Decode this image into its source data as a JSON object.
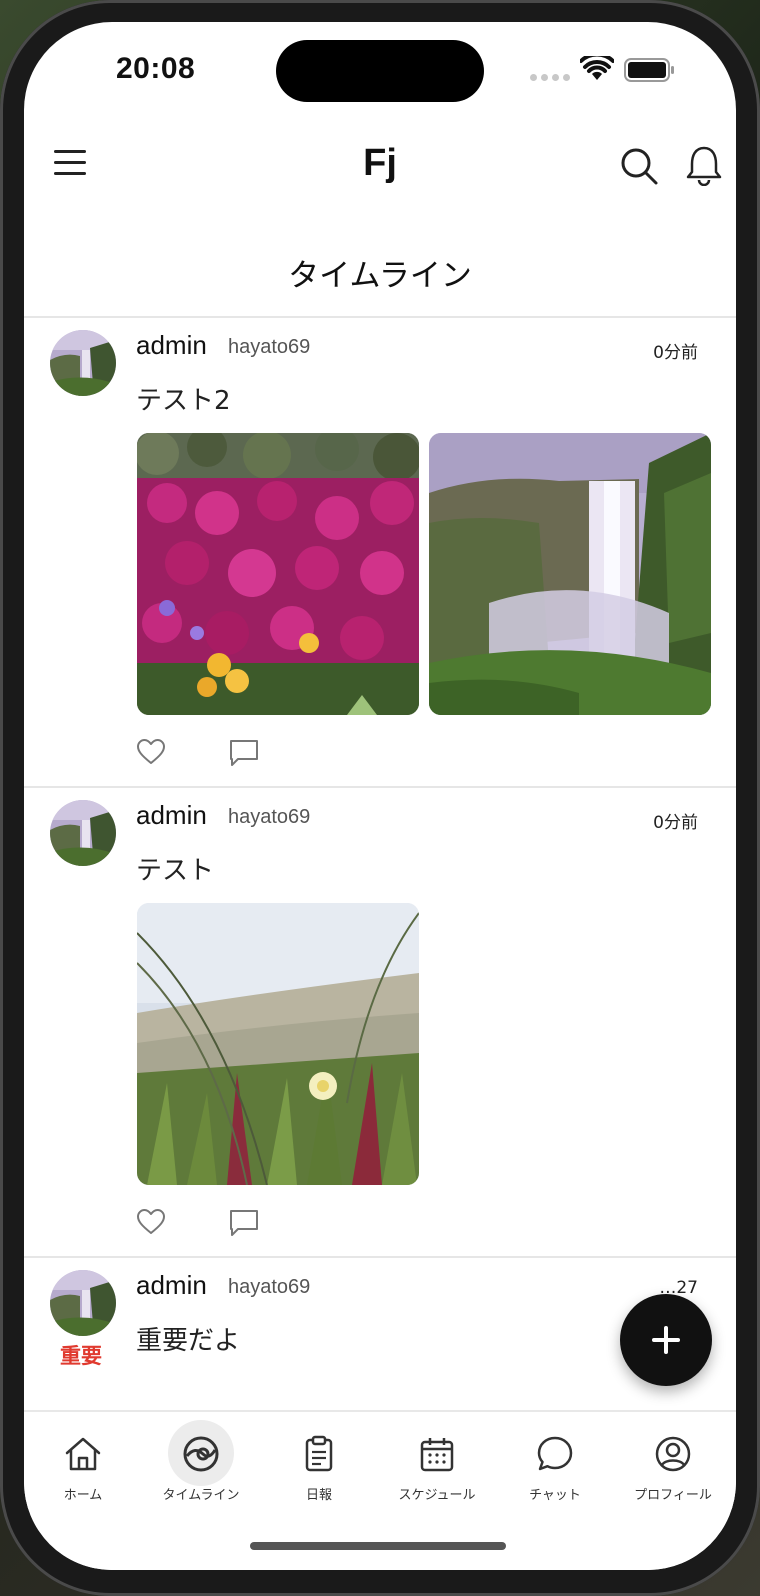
{
  "status_bar": {
    "time": "20:08"
  },
  "header": {
    "logo": "Fj",
    "page_title": "タイムライン"
  },
  "posts": [
    {
      "username": "admin",
      "handle": "hayato69",
      "time": "0分前",
      "text": "テスト2",
      "images": [
        "flowers-photo",
        "waterfall-photo"
      ]
    },
    {
      "username": "admin",
      "handle": "hayato69",
      "time": "0分前",
      "text": "テスト",
      "images": [
        "beach-plant-photo"
      ]
    },
    {
      "username": "admin",
      "handle": "hayato69",
      "time": "…27",
      "text": "重要だよ",
      "badge": "重要"
    }
  ],
  "fab": {
    "icon": "plus-icon"
  },
  "tabs": [
    {
      "label": "ホーム",
      "icon": "home-icon"
    },
    {
      "label": "タイムライン",
      "icon": "timeline-icon",
      "active": true
    },
    {
      "label": "日報",
      "icon": "clipboard-icon"
    },
    {
      "label": "スケジュール",
      "icon": "calendar-icon"
    },
    {
      "label": "チャット",
      "icon": "chat-icon"
    },
    {
      "label": "プロフィール",
      "icon": "profile-icon"
    }
  ],
  "colors": {
    "accent": "#111111",
    "important": "#e03a2f",
    "divider": "#e6e6e6"
  }
}
